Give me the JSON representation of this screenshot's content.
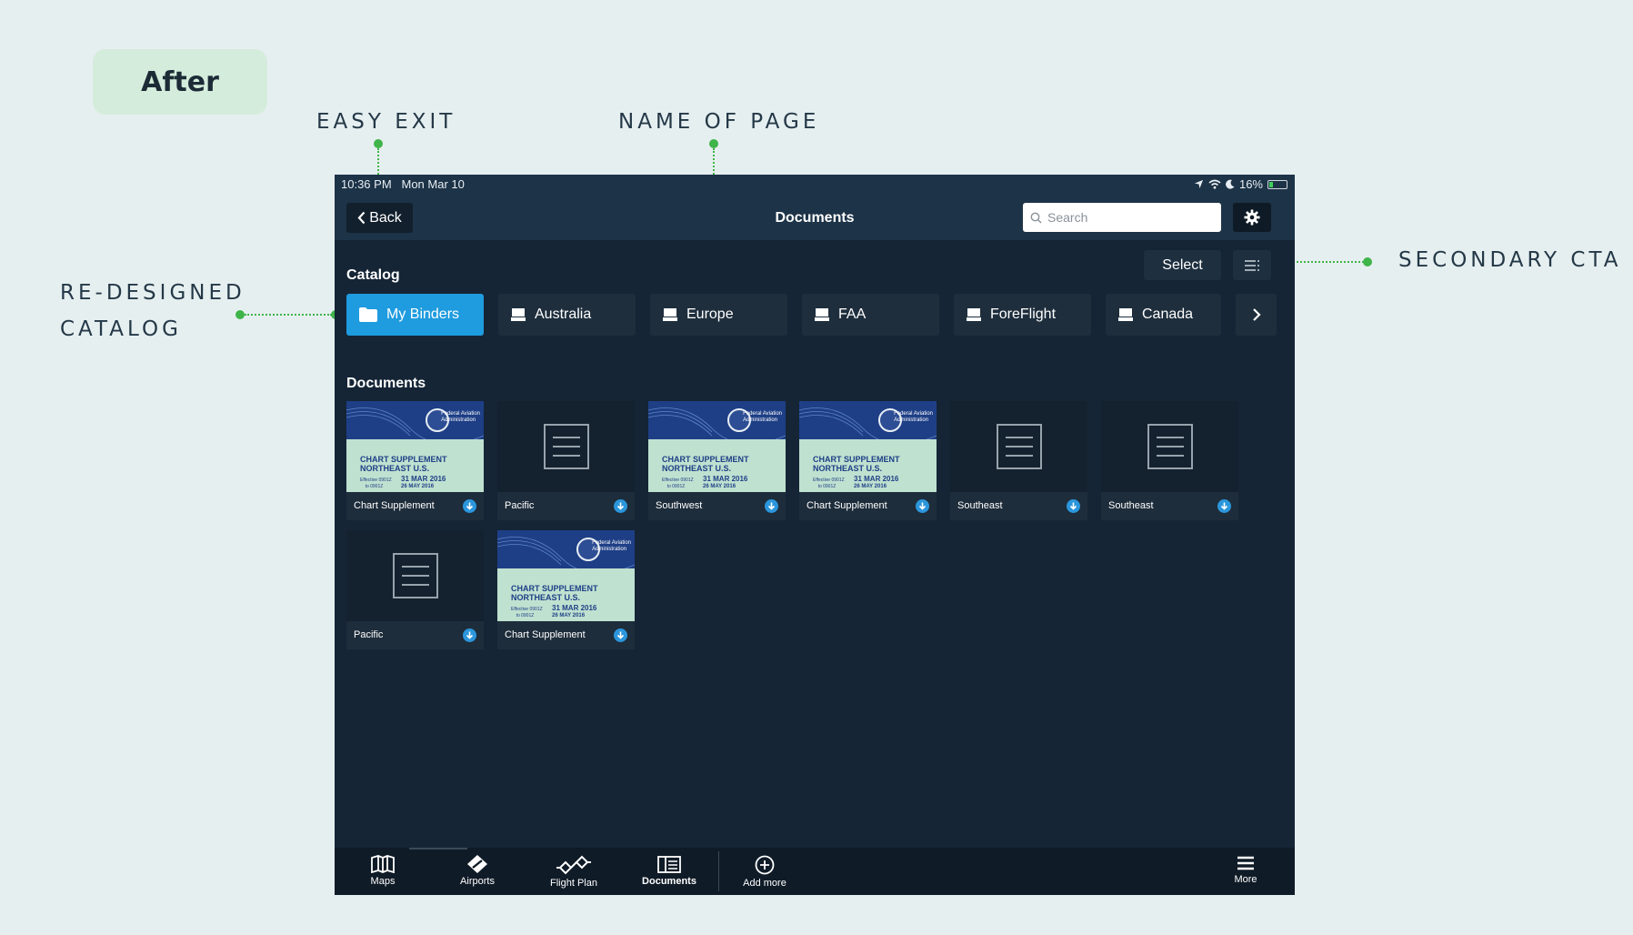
{
  "badge": "After",
  "annotations": {
    "easy_exit": "EASY EXIT",
    "name_of_page": "NAME OF PAGE",
    "secondary_cta": "SECONDARY CTA",
    "redesigned_line1": "RE-DESIGNED",
    "redesigned_line2": "CATALOG"
  },
  "status": {
    "time": "10:36 PM",
    "date": "Mon Mar 10",
    "battery": "16%"
  },
  "nav": {
    "back_label": "Back",
    "title": "Documents",
    "search_placeholder": "Search"
  },
  "actions": {
    "select_label": "Select"
  },
  "catalog": {
    "heading": "Catalog",
    "items": [
      {
        "label": "My Binders",
        "icon": "folder-icon"
      },
      {
        "label": "Australia",
        "icon": "drive-icon"
      },
      {
        "label": "Europe",
        "icon": "drive-icon"
      },
      {
        "label": "FAA",
        "icon": "drive-icon"
      },
      {
        "label": "ForeFlight",
        "icon": "drive-icon"
      },
      {
        "label": "Canada",
        "icon": "drive-icon"
      }
    ]
  },
  "documents": {
    "heading": "Documents",
    "cover": {
      "agency_line1": "Federal Aviation",
      "agency_line2": "Administration",
      "title_line1": "CHART SUPPLEMENT",
      "title_line2": "NORTHEAST U.S.",
      "effective_line1": "Effective 0901Z",
      "effective_line2": "to 0901Z",
      "date_from": "31 MAR 2016",
      "date_to": "26 MAY 2016"
    },
    "items": [
      {
        "label": "Chart Supplement",
        "thumb": "cover"
      },
      {
        "label": "Pacific",
        "thumb": "generic"
      },
      {
        "label": "Southwest",
        "thumb": "cover"
      },
      {
        "label": "Chart Supplement",
        "thumb": "cover"
      },
      {
        "label": "Southeast",
        "thumb": "generic"
      },
      {
        "label": "Southeast",
        "thumb": "generic"
      },
      {
        "label": "Pacific",
        "thumb": "generic"
      },
      {
        "label": "Chart Supplement",
        "thumb": "cover"
      }
    ]
  },
  "tabbar": {
    "maps": "Maps",
    "airports": "Airports",
    "flight_plan": "Flight Plan",
    "documents": "Documents",
    "add_more": "Add more",
    "more": "More"
  },
  "colors": {
    "accent": "#1f9bdf",
    "annotation_green": "#3fb449",
    "device_bg": "#152536"
  }
}
